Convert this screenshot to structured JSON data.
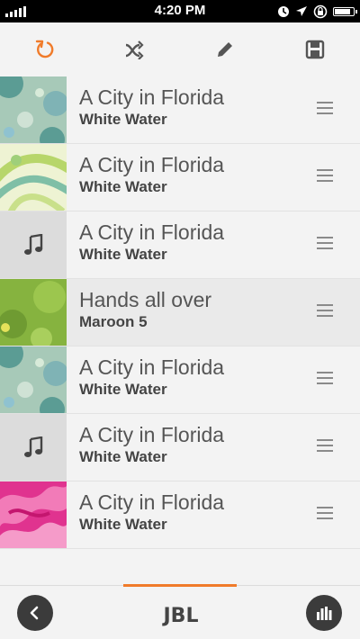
{
  "status_bar": {
    "time": "4:20 PM",
    "battery_level": 0.9
  },
  "toolbar": {
    "accent_color": "#f07b2a",
    "icons": [
      "refresh-icon",
      "shuffle-icon",
      "edit-icon",
      "save-icon"
    ]
  },
  "playlist": [
    {
      "title": "A City in Florida",
      "artist": "White Water",
      "art": "teal-bubbles"
    },
    {
      "title": "A City in Florida",
      "artist": "White Water",
      "art": "green-swirls"
    },
    {
      "title": "A City in Florida",
      "artist": "White Water",
      "art": "music-note-placeholder"
    },
    {
      "title": "Hands all over",
      "artist": "Maroon 5",
      "art": "green-lime",
      "selected": true
    },
    {
      "title": "A City in Florida",
      "artist": "White Water",
      "art": "teal-bubbles"
    },
    {
      "title": "A City in Florida",
      "artist": "White Water",
      "art": "music-note-placeholder"
    },
    {
      "title": "A City in Florida",
      "artist": "White Water",
      "art": "pink-flames"
    }
  ],
  "bottom_bar": {
    "logo": "JBL",
    "back": "back-icon",
    "equalizer": "equalizer-icon"
  }
}
